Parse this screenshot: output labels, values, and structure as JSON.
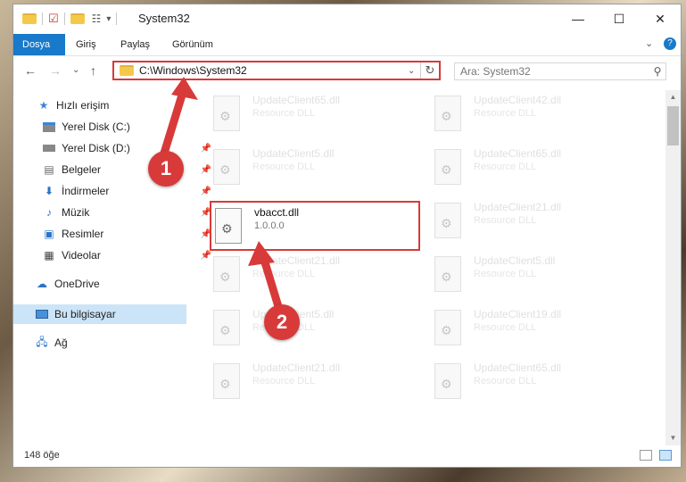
{
  "titlebar": {
    "title": "System32",
    "minimize": "—",
    "maximize": "☐",
    "close": "✕"
  },
  "ribbon": {
    "tabs": [
      {
        "label": "Dosya",
        "active": true
      },
      {
        "label": "Giriş",
        "active": false
      },
      {
        "label": "Paylaş",
        "active": false
      },
      {
        "label": "Görünüm",
        "active": false
      }
    ],
    "expand": "⌄",
    "help": "?"
  },
  "nav": {
    "back": "←",
    "forward": "→",
    "recent": "⌄",
    "up": "↑",
    "address": "C:\\Windows\\System32",
    "search_placeholder": "Ara: System32"
  },
  "sidebar": {
    "items": [
      {
        "label": "Hızlı erişim",
        "icon": "star-icon"
      },
      {
        "label": "Yerel Disk (C:)",
        "icon": "drive-icon"
      },
      {
        "label": "Yerel Disk (D:)",
        "icon": "drive-icon"
      },
      {
        "label": "Belgeler",
        "icon": "document-icon"
      },
      {
        "label": "İndirmeler",
        "icon": "download-icon"
      },
      {
        "label": "Müzik",
        "icon": "music-icon"
      },
      {
        "label": "Resimler",
        "icon": "pictures-icon"
      },
      {
        "label": "Videolar",
        "icon": "video-icon"
      },
      {
        "label": "OneDrive",
        "icon": "cloud-icon"
      },
      {
        "label": "Bu bilgisayar",
        "icon": "computer-icon"
      },
      {
        "label": "Ağ",
        "icon": "network-icon"
      }
    ]
  },
  "files": [
    {
      "name": "UpdateClient65.dll",
      "desc": "Resource DLL"
    },
    {
      "name": "UpdateClient42.dll",
      "desc": "Resource DLL"
    },
    {
      "name": "UpdateClient5.dll",
      "desc": "Resource DLL"
    },
    {
      "name": "UpdateClient65.dll",
      "desc": "Resource DLL"
    },
    {
      "name": "vbacct.dll",
      "desc": "1.0.0.0"
    },
    {
      "name": "UpdateClient21.dll",
      "desc": "Resource DLL"
    },
    {
      "name": "UpdateClient21.dll",
      "desc": "Resource DLL"
    },
    {
      "name": "UpdateClient5.dll",
      "desc": "Resource DLL"
    },
    {
      "name": "UpdateClient5.dll",
      "desc": "Resource DLL"
    },
    {
      "name": "UpdateClient19.dll",
      "desc": "Resource DLL"
    },
    {
      "name": "UpdateClient21.dll",
      "desc": "Resource DLL"
    },
    {
      "name": "UpdateClient65.dll",
      "desc": "Resource DLL"
    }
  ],
  "status": {
    "count": "148 öğe"
  },
  "annotations": {
    "step1": "1",
    "step2": "2",
    "color": "#d83a3a"
  },
  "colors": {
    "accent": "#1979ca",
    "selected": "#cce4f7",
    "highlight": "#d83a3a"
  }
}
